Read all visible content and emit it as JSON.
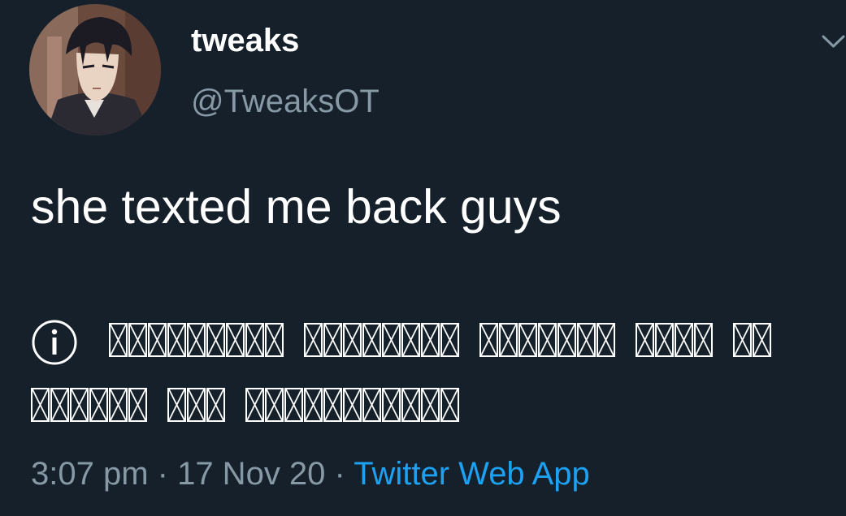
{
  "tweet": {
    "author": {
      "display_name": "tweaks",
      "handle": "@TweaksOT",
      "avatar_icon": "anime-character-avatar"
    },
    "text": "she texted me back guys",
    "notice": {
      "icon": "info-icon",
      "line1_word_lengths": [
        9,
        8,
        7,
        4,
        2
      ],
      "line2_word_lengths": [
        6,
        3,
        11
      ]
    },
    "meta": {
      "time": "3:07 pm",
      "separator": " · ",
      "date": "17 Nov 20",
      "source": "Twitter Web App"
    },
    "menu_icon": "chevron-down-icon"
  },
  "colors": {
    "background": "#15202b",
    "primary_text": "#ffffff",
    "secondary_text": "#8899a6",
    "link": "#1da1f2"
  }
}
